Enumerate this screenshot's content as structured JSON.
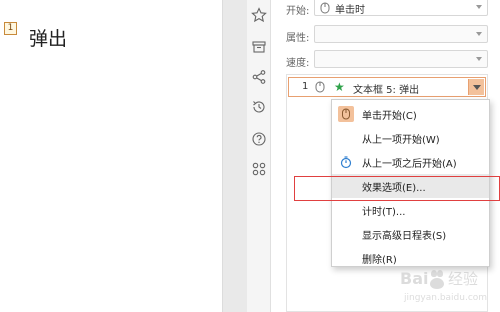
{
  "slide": {
    "order_badge": "1",
    "text": "弹出"
  },
  "pane": {
    "start_label": "开始:",
    "start_value": "单击时",
    "property_label": "属性:",
    "speed_label": "速度:",
    "animation_item": {
      "order": "1",
      "name": "文本框 5: 弹出"
    }
  },
  "context_menu": {
    "items": [
      {
        "label": "单击开始(C)",
        "icon": "mouse-click-icon",
        "selected": true
      },
      {
        "label": "从上一项开始(W)",
        "icon": "",
        "selected": false
      },
      {
        "label": "从上一项之后开始(A)",
        "icon": "clock-icon",
        "selected": false
      },
      {
        "label": "效果选项(E)...",
        "icon": "",
        "selected": false,
        "hover": true
      },
      {
        "label": "计时(T)...",
        "icon": "",
        "selected": false
      },
      {
        "label": "显示高级日程表(S)",
        "icon": "",
        "selected": false
      },
      {
        "label": "删除(R)",
        "icon": "",
        "selected": false
      }
    ]
  },
  "iconbar": {
    "icons": [
      "star-icon",
      "archive-icon",
      "share-icon",
      "history-icon",
      "help-icon",
      "apps-grid-icon"
    ]
  },
  "watermark": {
    "brand": "Baidu 经验",
    "url": "jingyan.baidu.com"
  },
  "colors": {
    "accent_orange": "#f3c19b",
    "highlight_red": "#e04040",
    "star_green": "#2fa24a"
  }
}
